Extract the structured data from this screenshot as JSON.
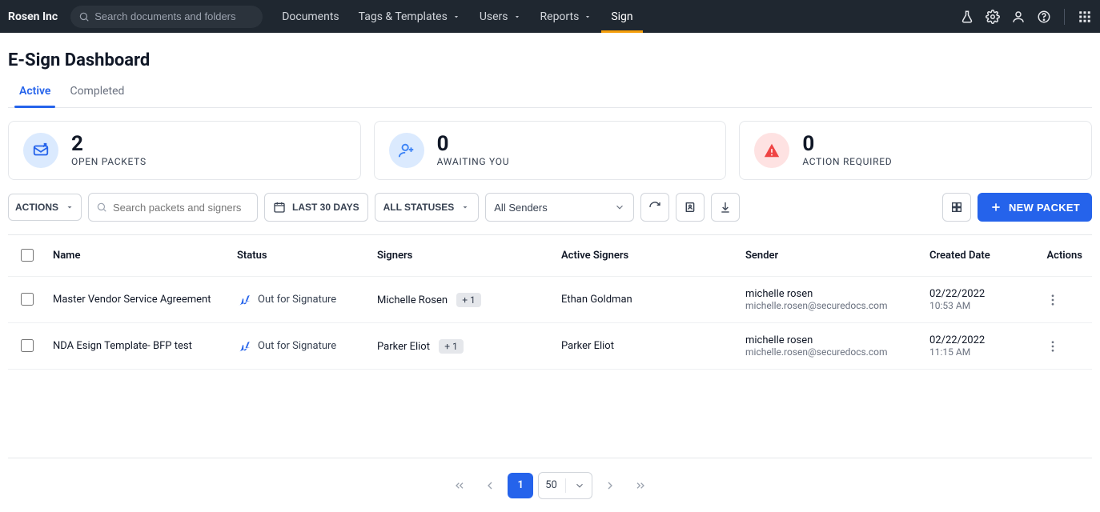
{
  "brand": "Rosen Inc",
  "topSearchPlaceholder": "Search documents and folders",
  "nav": {
    "items": [
      "Documents",
      "Tags & Templates",
      "Users",
      "Reports",
      "Sign"
    ],
    "activeIndex": 4
  },
  "page": {
    "title": "E-Sign Dashboard",
    "tabs": {
      "items": [
        "Active",
        "Completed"
      ],
      "activeIndex": 0
    }
  },
  "stats": [
    {
      "value": "2",
      "label": "OPEN PACKETS",
      "icon": "envelope-arrow-icon",
      "color": "blue"
    },
    {
      "value": "0",
      "label": "AWAITING YOU",
      "icon": "user-plus-icon",
      "color": "blue2"
    },
    {
      "value": "0",
      "label": "ACTION REQUIRED",
      "icon": "warning-triangle-icon",
      "color": "red"
    }
  ],
  "toolbar": {
    "actionsLabel": "ACTIONS",
    "searchPlaceholder": "Search packets and signers",
    "dateLabel": "LAST 30 DAYS",
    "statusLabel": "ALL STATUSES",
    "senderSelected": "All Senders",
    "newPacketLabel": "NEW PACKET"
  },
  "table": {
    "columns": [
      "Name",
      "Status",
      "Signers",
      "Active Signers",
      "Sender",
      "Created Date",
      "Actions"
    ],
    "rows": [
      {
        "name": "Master Vendor Service Agreement",
        "status": "Out for Signature",
        "signers": {
          "primary": "Michelle Rosen",
          "more": "+ 1"
        },
        "activeSigners": "Ethan Goldman",
        "sender": {
          "name": "michelle rosen",
          "email": "michelle.rosen@securedocs.com"
        },
        "created": {
          "date": "02/22/2022",
          "time": "10:53 AM"
        }
      },
      {
        "name": "NDA Esign Template- BFP test",
        "status": "Out for Signature",
        "signers": {
          "primary": "Parker Eliot",
          "more": "+ 1"
        },
        "activeSigners": "Parker Eliot",
        "sender": {
          "name": "michelle rosen",
          "email": "michelle.rosen@securedocs.com"
        },
        "created": {
          "date": "02/22/2022",
          "time": "11:15 AM"
        }
      }
    ]
  },
  "pager": {
    "current": "1",
    "pageSize": "50"
  }
}
